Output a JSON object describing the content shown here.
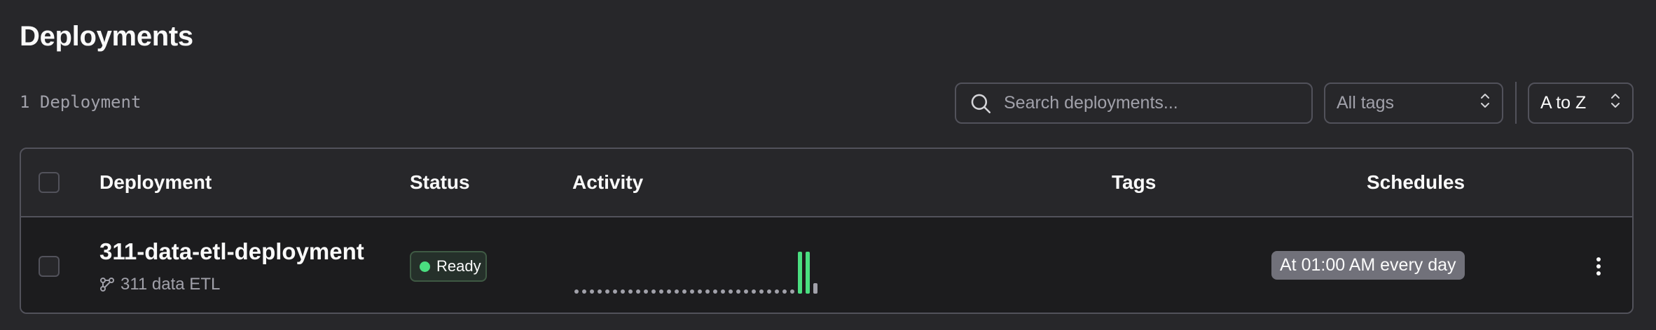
{
  "page": {
    "title": "Deployments",
    "count_label": "1 Deployment"
  },
  "toolbar": {
    "search_placeholder": "Search deployments...",
    "search_icon": "search-icon",
    "tags_select_value": "All tags",
    "sort_select_value": "A to Z"
  },
  "table": {
    "headers": {
      "deployment": "Deployment",
      "status": "Status",
      "activity": "Activity",
      "tags": "Tags",
      "schedules": "Schedules"
    },
    "rows": [
      {
        "name": "311-data-etl-deployment",
        "flow_name": "311 data ETL",
        "flow_icon": "flow-icon",
        "status": "Ready",
        "status_color": "#4ade80",
        "schedule": "At 01:00 AM every day",
        "activity": {
          "empty_slots": 29,
          "runs": [
            {
              "state": "completed",
              "level": 1.0,
              "color": "#4ade80"
            },
            {
              "state": "completed",
              "level": 1.0,
              "color": "#4ade80"
            },
            {
              "state": "pending",
              "level": 0.25,
              "color": "#a1a1aa"
            }
          ]
        }
      }
    ]
  }
}
